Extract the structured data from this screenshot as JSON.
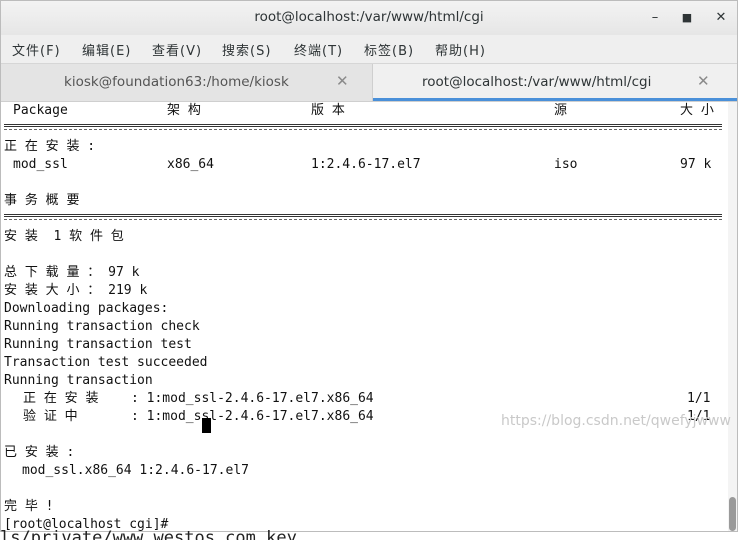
{
  "window": {
    "title": "root@localhost:/var/www/html/cgi",
    "minimize_glyph": "–",
    "maximize_glyph": "■",
    "close_glyph": "✕"
  },
  "menu": [
    {
      "label": "文件(F)"
    },
    {
      "label": "编辑(E)"
    },
    {
      "label": "查看(V)"
    },
    {
      "label": "搜索(S)"
    },
    {
      "label": "终端(T)"
    },
    {
      "label": "标签(B)"
    },
    {
      "label": "帮助(H)"
    }
  ],
  "tabs": [
    {
      "label": "kiosk@foundation63:/home/kiosk",
      "close_glyph": "✕",
      "active": false
    },
    {
      "label": "root@localhost:/var/www/html/cgi",
      "close_glyph": "✕",
      "active": true
    }
  ],
  "terminal": {
    "table_header": {
      "package": "Package",
      "arch": "架 构",
      "version": "版 本",
      "repo": "源",
      "size": "大 小"
    },
    "installing_label": "正 在 安 装 :",
    "package_row": {
      "name": "mod_ssl",
      "arch": "x86_64",
      "version": "1:2.4.6-17.el7",
      "repo": "iso",
      "size": "97 k"
    },
    "summary_label": "事 务 概 要",
    "install_count": "安 装  1 软 件 包",
    "total_download": "总 下 载 量 ： 97 k",
    "installed_size": "安 装 大 小 ： 219 k",
    "log_lines": [
      "Downloading packages:",
      "Running transaction check",
      "Running transaction test",
      "Transaction test succeeded",
      "Running transaction"
    ],
    "steps": [
      {
        "label": "正 在 安 装",
        "detail": ": 1:mod_ssl-2.4.6-17.el7.x86_64",
        "progress": "1/1"
      },
      {
        "label": "验 证 中",
        "detail": ": 1:mod_ssl-2.4.6-17.el7.x86_64",
        "progress": "1/1"
      }
    ],
    "installed_label": "已 安 装 :",
    "installed_pkg": "mod_ssl.x86_64 1:2.4.6-17.el7",
    "done": "完 毕 !",
    "prompt": "[root@localhost cgi]#"
  },
  "watermark": "https://blog.csdn.net/qwefyjwww",
  "behind_text": "ls/private/www.westos.com.key"
}
